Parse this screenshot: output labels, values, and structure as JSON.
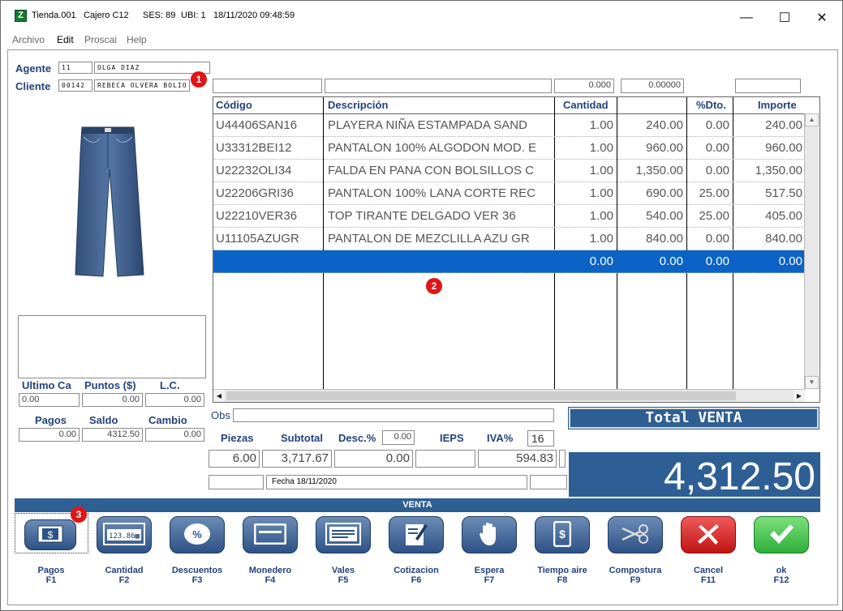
{
  "window": {
    "app_icon": "app-logo-icon",
    "app_icon_letter": "Z",
    "store": "Tienda.001",
    "cashier": "Cajero C12",
    "session": "SES: 89",
    "ubi": "UBI: 1",
    "datetime": "18/11/2020 09:48:59",
    "minimize": "—",
    "maximize": "☐",
    "close": "✕"
  },
  "menu": [
    "Archivo",
    "Edit",
    "Proscai",
    "Help"
  ],
  "left": {
    "agent_label": "Agente",
    "agent_code": "11",
    "agent_name": "OLGA DIAZ",
    "client_label": "Cliente",
    "client_code": "00142",
    "client_name": "REBECA OLVERA BOLIO",
    "ultimo_label": "Ultimo Ca",
    "puntos_label": "Puntos ($)",
    "lc_label": "L.C.",
    "ultimo_value": "0.00",
    "puntos_value": "0.00",
    "lc_value": "0.00",
    "pagos_label": "Pagos",
    "saldo_label": "Saldo",
    "cambio_label": "Cambio",
    "pagos_value": "0.00",
    "saldo_value": "4312.50",
    "cambio_value": "0.00"
  },
  "topfields": {
    "qty": "0.000",
    "price": "0.00000"
  },
  "grid": {
    "headers": [
      "Código",
      "Descripción",
      "Cantidad",
      "",
      "%Dto.",
      "Importe"
    ],
    "rows": [
      [
        "U44406SAN16",
        "PLAYERA NIÑA ESTAMPADA SAND",
        "1.00",
        "240.00",
        "0.00",
        "240.00"
      ],
      [
        "U33312BEI12",
        "PANTALON 100% ALGODON MOD. E",
        "1.00",
        "960.00",
        "0.00",
        "960.00"
      ],
      [
        "U22232OLI34",
        "FALDA EN PANA CON BOLSILLOS C",
        "1.00",
        "1,350.00",
        "0.00",
        "1,350.00"
      ],
      [
        "U22206GRI36",
        "PANTALON 100% LANA CORTE REC",
        "1.00",
        "690.00",
        "25.00",
        "517.50"
      ],
      [
        "U22210VER36",
        "TOP TIRANTE DELGADO VER 36",
        "1.00",
        "540.00",
        "25.00",
        "405.00"
      ],
      [
        "U11105AZUGR",
        "PANTALON DE MEZCLILLA AZU GR",
        "1.00",
        "840.00",
        "0.00",
        "840.00"
      ],
      [
        "",
        "",
        "0.00",
        "0.00",
        "0.00",
        "0.00"
      ]
    ]
  },
  "summary": {
    "obs_label": "Obs",
    "piezas_label": "Piezas",
    "subtotal_label": "Subtotal",
    "desc_label": "Desc.%",
    "desc_value": "0.00",
    "ieps_label": "IEPS",
    "iva_label": "IVA%",
    "iva_value": "16",
    "piezas_value": "6.00",
    "subtotal_value": "3,717.67",
    "desc_amount": "0.00",
    "iva_amount": "594.83",
    "fecha": "Fecha 18/11/2020",
    "total_label": "Total VENTA",
    "total_value": "4,312.50"
  },
  "venta_label": "VENTA",
  "badges": [
    "1",
    "2",
    "3"
  ],
  "functions": [
    {
      "label": "Pagos",
      "key": "F1",
      "icon": "cash-icon"
    },
    {
      "label": "Cantidad",
      "key": "F2",
      "icon": "calculator-icon"
    },
    {
      "label": "Descuentos",
      "key": "F3",
      "icon": "percent-icon"
    },
    {
      "label": "Monedero",
      "key": "F4",
      "icon": "wallet-card-icon"
    },
    {
      "label": "Vales",
      "key": "F5",
      "icon": "voucher-icon"
    },
    {
      "label": "Cotizacion",
      "key": "F6",
      "icon": "quote-edit-icon"
    },
    {
      "label": "Espera",
      "key": "F7",
      "icon": "hand-stop-icon"
    },
    {
      "label": "Tiempo aire",
      "key": "F8",
      "icon": "phone-dollar-icon"
    },
    {
      "label": "Compostura",
      "key": "F9",
      "icon": "scissors-icon"
    },
    {
      "label": "Cancel",
      "key": "F11",
      "icon": "cancel-x-icon"
    },
    {
      "label": "ok",
      "key": "F12",
      "icon": "checkmark-icon"
    }
  ],
  "colors": {
    "accent": "#2e5f94",
    "selection": "#0b63c8",
    "badge": "#e01515"
  }
}
